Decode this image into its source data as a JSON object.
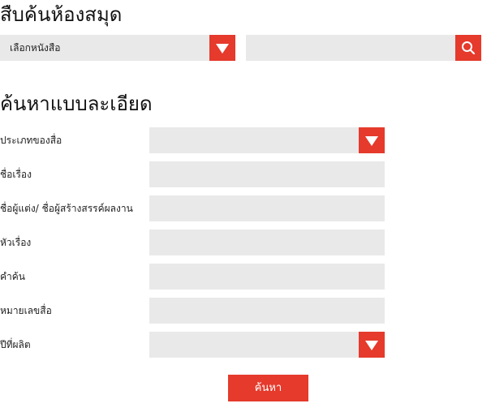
{
  "quick_search": {
    "title": "สืบค้นห้องสมุด",
    "book_select_value": "เลือกหนังสือ",
    "search_input_value": "",
    "search_button_icon": "search-icon"
  },
  "advanced_search": {
    "title": "ค้นหาแบบละเอียด",
    "fields": {
      "media_type": {
        "label": "ประเภทของสื่อ",
        "value": ""
      },
      "title": {
        "label": "ชื่อเรื่อง",
        "value": ""
      },
      "author": {
        "label": "ชื่อผู้แต่ง/ ชื่อผู้สร้างสรรค์ผลงาน",
        "value": ""
      },
      "subject": {
        "label": "หัวเรื่อง",
        "value": ""
      },
      "keyword": {
        "label": "คำค้น",
        "value": ""
      },
      "call_number": {
        "label": "หมายเลขสื่อ",
        "value": ""
      },
      "year": {
        "label": "ปีที่ผลิต",
        "value": ""
      }
    },
    "submit_label": "ค้นหา"
  },
  "colors": {
    "accent": "#e53a2c",
    "field_background": "#e9e9e9"
  }
}
